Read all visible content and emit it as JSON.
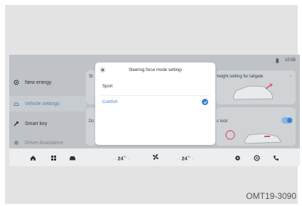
{
  "status": {
    "time": "10:55",
    "icon": "bluetooth-icon"
  },
  "sidebar": {
    "items": [
      {
        "label": "New energy",
        "icon": "gear-plug-icon"
      },
      {
        "label": "Vehicle settings",
        "icon": "car-icon"
      },
      {
        "label": "Smart key",
        "icon": "key-icon"
      },
      {
        "label": "Driver Assistance",
        "icon": "steering-icon"
      }
    ]
  },
  "cards": {
    "left_top_partial": "St",
    "left_bottom_partial": "Dc",
    "right_top": "height setting for tailgate",
    "right_bottom": "c lock"
  },
  "dialog": {
    "title": "Steering force mode settingı",
    "options": [
      {
        "label": "Sport",
        "selected": false
      },
      {
        "label": "Comfort",
        "selected": true
      }
    ]
  },
  "dock": {
    "left_temp": "24",
    "right_temp": "24",
    "unit": "°C",
    "icons": [
      "home-icon",
      "apps-grid-icon",
      "car-icon",
      "fan-icon",
      "settings-icon",
      "steering-wheel-icon",
      "phone-icon"
    ]
  },
  "colors": {
    "accent": "#3c7fd0",
    "active_text": "#5a7fa8",
    "screen_bg": "#bfc3c7",
    "dock_bg": "#eceef0"
  },
  "caption": "OMT19-3090"
}
